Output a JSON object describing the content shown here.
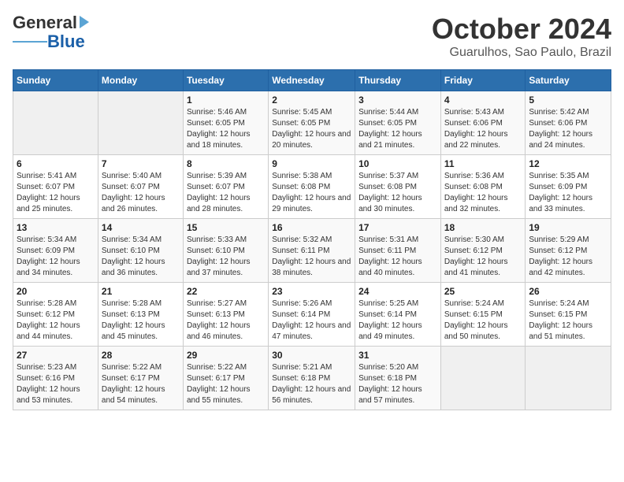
{
  "header": {
    "logo_general": "General",
    "logo_blue": "Blue",
    "title": "October 2024",
    "subtitle": "Guarulhos, Sao Paulo, Brazil"
  },
  "calendar": {
    "weekdays": [
      "Sunday",
      "Monday",
      "Tuesday",
      "Wednesday",
      "Thursday",
      "Friday",
      "Saturday"
    ],
    "weeks": [
      [
        {
          "day": "",
          "info": ""
        },
        {
          "day": "",
          "info": ""
        },
        {
          "day": "1",
          "info": "Sunrise: 5:46 AM\nSunset: 6:05 PM\nDaylight: 12 hours and 18 minutes."
        },
        {
          "day": "2",
          "info": "Sunrise: 5:45 AM\nSunset: 6:05 PM\nDaylight: 12 hours and 20 minutes."
        },
        {
          "day": "3",
          "info": "Sunrise: 5:44 AM\nSunset: 6:05 PM\nDaylight: 12 hours and 21 minutes."
        },
        {
          "day": "4",
          "info": "Sunrise: 5:43 AM\nSunset: 6:06 PM\nDaylight: 12 hours and 22 minutes."
        },
        {
          "day": "5",
          "info": "Sunrise: 5:42 AM\nSunset: 6:06 PM\nDaylight: 12 hours and 24 minutes."
        }
      ],
      [
        {
          "day": "6",
          "info": "Sunrise: 5:41 AM\nSunset: 6:07 PM\nDaylight: 12 hours and 25 minutes."
        },
        {
          "day": "7",
          "info": "Sunrise: 5:40 AM\nSunset: 6:07 PM\nDaylight: 12 hours and 26 minutes."
        },
        {
          "day": "8",
          "info": "Sunrise: 5:39 AM\nSunset: 6:07 PM\nDaylight: 12 hours and 28 minutes."
        },
        {
          "day": "9",
          "info": "Sunrise: 5:38 AM\nSunset: 6:08 PM\nDaylight: 12 hours and 29 minutes."
        },
        {
          "day": "10",
          "info": "Sunrise: 5:37 AM\nSunset: 6:08 PM\nDaylight: 12 hours and 30 minutes."
        },
        {
          "day": "11",
          "info": "Sunrise: 5:36 AM\nSunset: 6:08 PM\nDaylight: 12 hours and 32 minutes."
        },
        {
          "day": "12",
          "info": "Sunrise: 5:35 AM\nSunset: 6:09 PM\nDaylight: 12 hours and 33 minutes."
        }
      ],
      [
        {
          "day": "13",
          "info": "Sunrise: 5:34 AM\nSunset: 6:09 PM\nDaylight: 12 hours and 34 minutes."
        },
        {
          "day": "14",
          "info": "Sunrise: 5:34 AM\nSunset: 6:10 PM\nDaylight: 12 hours and 36 minutes."
        },
        {
          "day": "15",
          "info": "Sunrise: 5:33 AM\nSunset: 6:10 PM\nDaylight: 12 hours and 37 minutes."
        },
        {
          "day": "16",
          "info": "Sunrise: 5:32 AM\nSunset: 6:11 PM\nDaylight: 12 hours and 38 minutes."
        },
        {
          "day": "17",
          "info": "Sunrise: 5:31 AM\nSunset: 6:11 PM\nDaylight: 12 hours and 40 minutes."
        },
        {
          "day": "18",
          "info": "Sunrise: 5:30 AM\nSunset: 6:12 PM\nDaylight: 12 hours and 41 minutes."
        },
        {
          "day": "19",
          "info": "Sunrise: 5:29 AM\nSunset: 6:12 PM\nDaylight: 12 hours and 42 minutes."
        }
      ],
      [
        {
          "day": "20",
          "info": "Sunrise: 5:28 AM\nSunset: 6:12 PM\nDaylight: 12 hours and 44 minutes."
        },
        {
          "day": "21",
          "info": "Sunrise: 5:28 AM\nSunset: 6:13 PM\nDaylight: 12 hours and 45 minutes."
        },
        {
          "day": "22",
          "info": "Sunrise: 5:27 AM\nSunset: 6:13 PM\nDaylight: 12 hours and 46 minutes."
        },
        {
          "day": "23",
          "info": "Sunrise: 5:26 AM\nSunset: 6:14 PM\nDaylight: 12 hours and 47 minutes."
        },
        {
          "day": "24",
          "info": "Sunrise: 5:25 AM\nSunset: 6:14 PM\nDaylight: 12 hours and 49 minutes."
        },
        {
          "day": "25",
          "info": "Sunrise: 5:24 AM\nSunset: 6:15 PM\nDaylight: 12 hours and 50 minutes."
        },
        {
          "day": "26",
          "info": "Sunrise: 5:24 AM\nSunset: 6:15 PM\nDaylight: 12 hours and 51 minutes."
        }
      ],
      [
        {
          "day": "27",
          "info": "Sunrise: 5:23 AM\nSunset: 6:16 PM\nDaylight: 12 hours and 53 minutes."
        },
        {
          "day": "28",
          "info": "Sunrise: 5:22 AM\nSunset: 6:17 PM\nDaylight: 12 hours and 54 minutes."
        },
        {
          "day": "29",
          "info": "Sunrise: 5:22 AM\nSunset: 6:17 PM\nDaylight: 12 hours and 55 minutes."
        },
        {
          "day": "30",
          "info": "Sunrise: 5:21 AM\nSunset: 6:18 PM\nDaylight: 12 hours and 56 minutes."
        },
        {
          "day": "31",
          "info": "Sunrise: 5:20 AM\nSunset: 6:18 PM\nDaylight: 12 hours and 57 minutes."
        },
        {
          "day": "",
          "info": ""
        },
        {
          "day": "",
          "info": ""
        }
      ]
    ]
  }
}
